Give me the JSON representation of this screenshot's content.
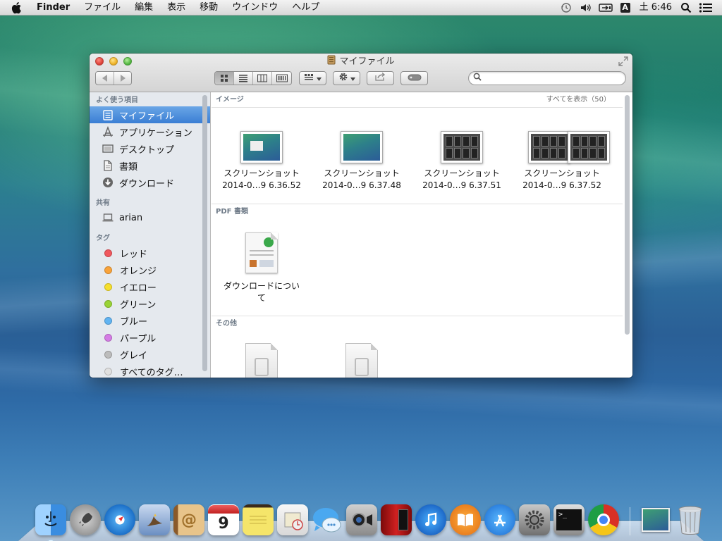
{
  "menubar": {
    "app_name": "Finder",
    "menus": [
      "ファイル",
      "編集",
      "表示",
      "移動",
      "ウインドウ",
      "ヘルプ"
    ],
    "input_source": "A",
    "clock": "土 6:46",
    "icons": [
      "apple-icon",
      "time-machine-icon",
      "volume-icon",
      "display-mirroring-icon",
      "input-source-icon",
      "spotlight-icon",
      "notification-center-icon"
    ]
  },
  "window": {
    "title": "マイファイル",
    "search_placeholder": "",
    "toolbar_icons": [
      "back-icon",
      "forward-icon",
      "icon-view-icon",
      "list-view-icon",
      "column-view-icon",
      "coverflow-view-icon",
      "arrange-icon",
      "action-gear-icon",
      "share-icon",
      "tags-icon",
      "search-icon"
    ]
  },
  "sidebar": {
    "favorites_header": "よく使う項目",
    "favorites": [
      {
        "label": "マイファイル",
        "icon": "all-my-files-icon",
        "selected": true
      },
      {
        "label": "アプリケーション",
        "icon": "applications-icon"
      },
      {
        "label": "デスクトップ",
        "icon": "desktop-icon"
      },
      {
        "label": "書類",
        "icon": "documents-icon"
      },
      {
        "label": "ダウンロード",
        "icon": "downloads-icon"
      }
    ],
    "shared_header": "共有",
    "shared": [
      {
        "label": "arian",
        "icon": "computer-icon"
      }
    ],
    "tags_header": "タグ",
    "tags": [
      {
        "label": "レッド",
        "color": "#f0585e"
      },
      {
        "label": "オレンジ",
        "color": "#f9a33a"
      },
      {
        "label": "イエロー",
        "color": "#f6df2d"
      },
      {
        "label": "グリーン",
        "color": "#99d335"
      },
      {
        "label": "ブルー",
        "color": "#61b4f2"
      },
      {
        "label": "パープル",
        "color": "#d57ce5"
      },
      {
        "label": "グレイ",
        "color": "#bcbcbc"
      },
      {
        "label": "すべてのタグ…",
        "color": "#e0e0e0"
      }
    ]
  },
  "content": {
    "images_header": "イメージ",
    "images_show_all": "すべてを表示（50）",
    "images": [
      {
        "line1": "スクリーンショット",
        "line2": "2014-0…9 6.36.52",
        "kind": "desktop"
      },
      {
        "line1": "スクリーンショット",
        "line2": "2014-0…9 6.37.48",
        "kind": "desktop"
      },
      {
        "line1": "スクリーンショット",
        "line2": "2014-0…9 6.37.51",
        "kind": "grid"
      },
      {
        "line1": "スクリーンショット",
        "line2": "2014-0…9 6.37.52",
        "kind": "grid"
      }
    ],
    "pdf_header": "PDF 書類",
    "pdfs": [
      {
        "line1": "ダウンロードについ",
        "line2": "て"
      }
    ],
    "other_header": "その他",
    "others": [
      {
        "name": ""
      },
      {
        "name": ""
      }
    ]
  },
  "dock": {
    "apps": [
      "finder-icon",
      "launchpad-icon",
      "safari-icon",
      "mail-icon",
      "contacts-icon",
      "calendar-icon",
      "notes-icon",
      "reminders-icon",
      "messages-icon",
      "facetime-icon",
      "photo-booth-icon",
      "itunes-icon",
      "ibooks-icon",
      "app-store-icon",
      "system-preferences-icon",
      "terminal-icon",
      "chrome-icon"
    ],
    "calendar_day": "9",
    "stacks": [
      "downloads-stack-icon",
      "trash-icon"
    ]
  }
}
